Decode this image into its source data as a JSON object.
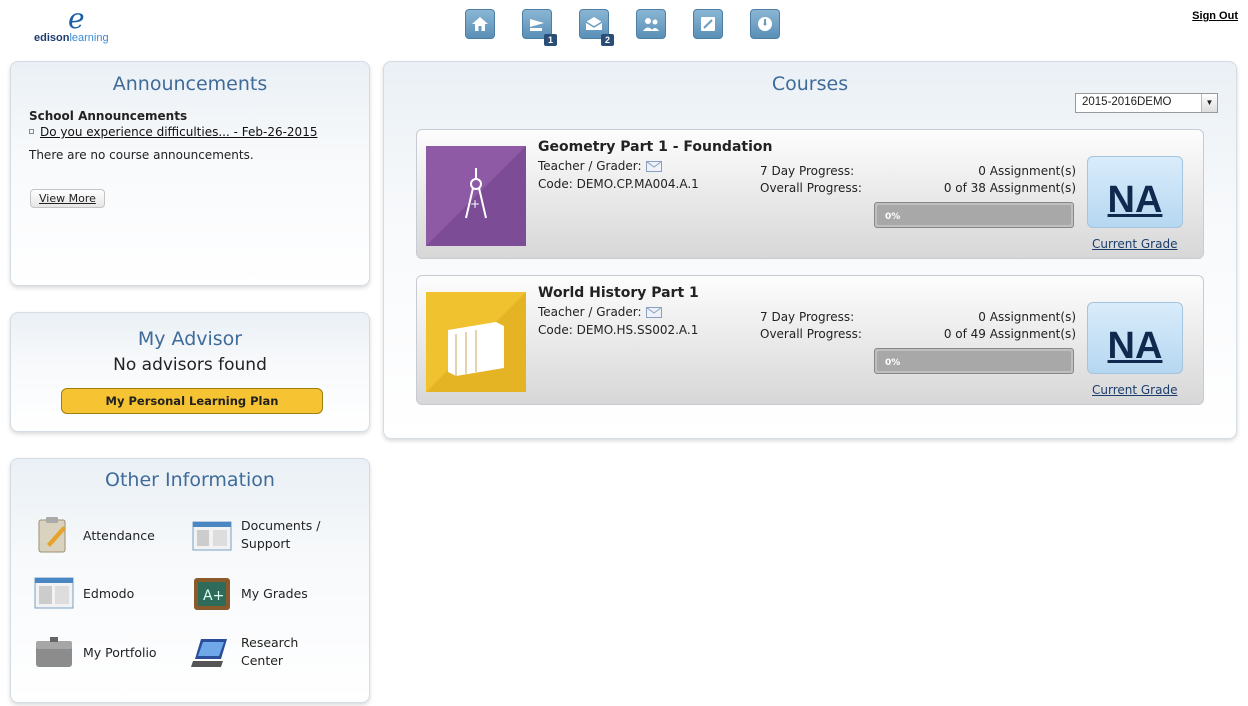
{
  "header": {
    "logo_text_a": "edison",
    "logo_text_b": "learning",
    "logo_mark": "e",
    "nav": [
      {
        "icon": "home-icon"
      },
      {
        "icon": "assignments-icon",
        "badge": "1"
      },
      {
        "icon": "messages-icon",
        "badge": "2"
      },
      {
        "icon": "people-icon"
      },
      {
        "icon": "notes-icon"
      },
      {
        "icon": "dashboard-icon"
      }
    ],
    "sign_out": "Sign Out"
  },
  "announcements": {
    "title": "Announcements",
    "school_heading": "School Announcements",
    "link": "Do you experience difficulties... - Feb-26-2015",
    "no_course": "There are no course announcements.",
    "view_more": "View More"
  },
  "advisor": {
    "title": "My Advisor",
    "none": "No advisors found",
    "plp_button": "My Personal Learning Plan"
  },
  "other": {
    "title": "Other Information",
    "items": [
      {
        "label": "Attendance",
        "icon": "clipboard-icon"
      },
      {
        "label": "Documents / Support",
        "icon": "documents-icon"
      },
      {
        "label": "Edmodo",
        "icon": "edmodo-icon"
      },
      {
        "label": "My Grades",
        "icon": "chalkboard-icon"
      },
      {
        "label": "My Portfolio",
        "icon": "portfolio-icon"
      },
      {
        "label": "Research Center",
        "icon": "laptop-icon"
      }
    ]
  },
  "courses": {
    "title": "Courses",
    "term": "2015-2016DEMO",
    "list": [
      {
        "name": "Geometry Part 1 - Foundation",
        "teacher": "Teacher / Grader:",
        "code": "Code: DEMO.CP.MA004.A.1",
        "label_7day": "7 Day Progress:",
        "label_overall": "Overall Progress:",
        "val_7day": "0 Assignment(s)",
        "val_overall": "0 of 38 Assignment(s)",
        "pct": "0%",
        "grade": "NA",
        "current_grade": "Current Grade",
        "color": "#8e5aa6",
        "icon": "compass-icon"
      },
      {
        "name": "World History Part 1",
        "teacher": "Teacher / Grader:",
        "code": "Code: DEMO.HS.SS002.A.1",
        "label_7day": "7 Day Progress:",
        "label_overall": "Overall Progress:",
        "val_7day": "0 Assignment(s)",
        "val_overall": "0 of 49 Assignment(s)",
        "pct": "0%",
        "grade": "NA",
        "current_grade": "Current Grade",
        "color": "#f0c230",
        "icon": "books-icon"
      }
    ]
  }
}
